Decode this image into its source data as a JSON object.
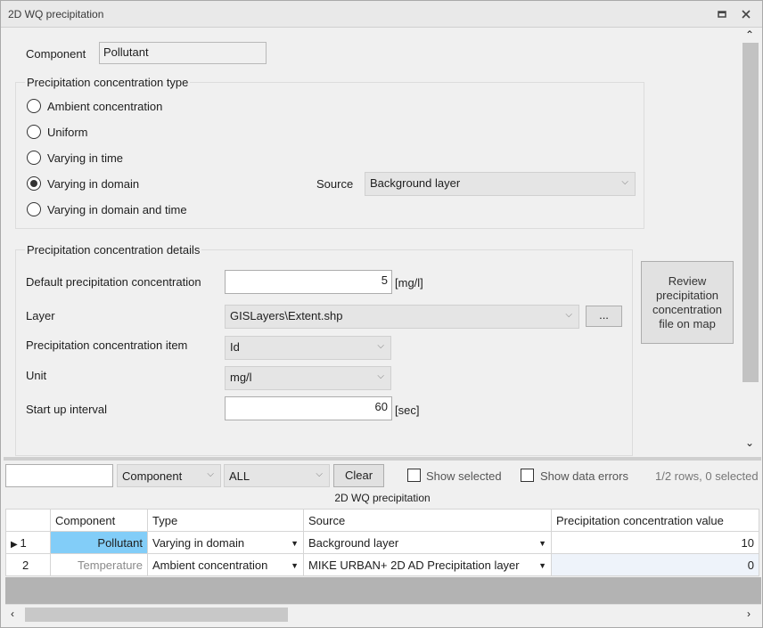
{
  "window": {
    "title": "2D WQ precipitation"
  },
  "form": {
    "component_label": "Component",
    "component_value": "Pollutant",
    "type_group_title": "Precipitation concentration type",
    "type_options": [
      {
        "label": "Ambient concentration",
        "checked": false
      },
      {
        "label": "Uniform",
        "checked": false
      },
      {
        "label": "Varying in time",
        "checked": false
      },
      {
        "label": "Varying in domain",
        "checked": true
      },
      {
        "label": "Varying in domain and time",
        "checked": false
      }
    ],
    "source_label": "Source",
    "source_value": "Background layer",
    "details_group_title": "Precipitation concentration details",
    "default_conc_label": "Default precipitation concentration",
    "default_conc_value": "5",
    "default_conc_unit": "[mg/l]",
    "layer_label": "Layer",
    "layer_value": "GISLayers\\Extent.shp",
    "browse_label": "...",
    "item_label": "Precipitation concentration item",
    "item_value": "Id",
    "unit_label": "Unit",
    "unit_value": "mg/l",
    "startup_label": "Start up  interval",
    "startup_value": "60",
    "startup_unit": "[sec]",
    "review_button": [
      "Review",
      "precipitation",
      "concentration",
      "file on map"
    ]
  },
  "filterbar": {
    "search_value": "",
    "field_value": "Component",
    "filter_value": "ALL",
    "clear_label": "Clear",
    "show_selected_label": "Show selected",
    "show_errors_label": "Show data errors",
    "row_status": "1/2 rows, 0 selected"
  },
  "grid": {
    "title": "2D WQ precipitation",
    "columns": [
      "",
      "Component",
      "Type",
      "Source",
      "Precipitation concentration value"
    ],
    "rows": [
      {
        "indicator": "▶",
        "num": "1",
        "component": "Pollutant",
        "type": "Varying in domain",
        "source": "Background layer",
        "value": "10"
      },
      {
        "indicator": "",
        "num": "2",
        "component": "Temperature",
        "type": "Ambient concentration",
        "source": "MIKE URBAN+ 2D AD Precipitation layer",
        "value": "0"
      }
    ]
  }
}
